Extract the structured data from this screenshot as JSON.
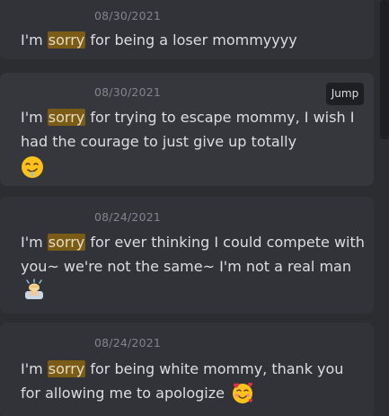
{
  "results": [
    {
      "timestamp": "08/30/2021",
      "before": "I'm ",
      "highlight": "sorry",
      "after": " for being a loser mommyyyy",
      "emoji": ""
    },
    {
      "timestamp": "08/30/2021",
      "before": "I'm ",
      "highlight": "sorry",
      "after": " for trying to escape mommy, I wish I had the courage to just give up totally",
      "emoji": "drooling-face-icon"
    },
    {
      "timestamp": "08/24/2021",
      "before": "I'm ",
      "highlight": "sorry",
      "after": " for ever thinking I could compete with you~ we're not the same~ I'm not a real man",
      "emoji": "person-bowing-icon"
    },
    {
      "timestamp": "08/24/2021",
      "before": "I'm ",
      "highlight": "sorry",
      "after": " for being white mommy, thank you for allowing me to apologize",
      "emoji": "smiling-face-with-hearts-icon"
    }
  ],
  "jump_label": "Jump",
  "colors": {
    "background": "#2b2d31",
    "card": "#313338",
    "highlight": "#7a5c16",
    "text": "#dbdee1",
    "muted": "#80848e"
  }
}
